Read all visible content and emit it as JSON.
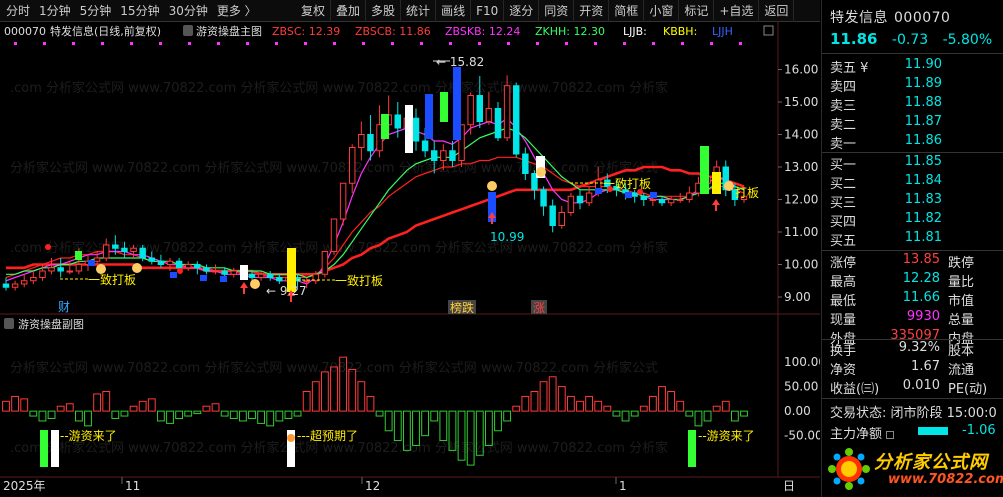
{
  "toolbar": {
    "periods": [
      "分时",
      "1分钟",
      "5分钟",
      "15分钟",
      "30分钟",
      "更多 〉"
    ],
    "buttons": [
      "复权",
      "叠加",
      "多股",
      "统计",
      "画线",
      "F10",
      "逐分",
      "同资",
      "开资",
      "简框",
      "小窗",
      "标记",
      "+自选",
      "返回"
    ]
  },
  "main_header": {
    "code": "000070",
    "name": "特发信息(日线,前复权)",
    "indicator": "游资操盘主图",
    "items": [
      {
        "label": "ZBSC: 12.39",
        "color": "#ff3b3b"
      },
      {
        "label": "ZBSCB: 11.86",
        "color": "#ff3b3b"
      },
      {
        "label": "ZBSKB: 12.24",
        "color": "#ff33ff"
      },
      {
        "label": "ZKHH: 12.30",
        "color": "#33ff66"
      },
      {
        "label": "LJJB:",
        "color": "#ffffff"
      },
      {
        "label": "KBBH:",
        "color": "#ffff00"
      },
      {
        "label": "LJJH",
        "color": "#3366ff"
      }
    ]
  },
  "sub_header": {
    "indicator": "游资操盘副图"
  },
  "annotations": {
    "high": "15.82",
    "low_a": "9.27",
    "low_b": "10.99",
    "yidaban_a": "一致打板",
    "yidaban_b": "一致打板",
    "yidaban_c": "一致打板",
    "bang_die": "榜跌",
    "zhang": "涨",
    "cai": "财",
    "youzi_a": "游资来了",
    "chaoyuqi": "超预期了",
    "youzi_b": "游资来了"
  },
  "date_axis": {
    "labels": [
      "2025年",
      "11",
      "12",
      "1",
      "日"
    ]
  },
  "chart_data": {
    "type": "candlestick",
    "y_ticks_main": [
      "16.00",
      "15.00",
      "14.00",
      "13.00",
      "12.00",
      "11.00",
      "10.00",
      "9.00"
    ],
    "y_ticks_sub": [
      "100.00",
      "50.00",
      "0.00",
      "-50.00"
    ],
    "ylim_main": [
      8.6,
      16.6
    ],
    "ylim_sub": [
      -120,
      145
    ],
    "candles": [
      [
        9.4,
        9.3,
        9.6,
        9.2
      ],
      [
        9.3,
        9.4,
        9.5,
        9.2
      ],
      [
        9.4,
        9.5,
        9.7,
        9.3
      ],
      [
        9.5,
        9.6,
        9.8,
        9.4
      ],
      [
        9.6,
        9.8,
        10.0,
        9.5
      ],
      [
        9.8,
        9.9,
        10.2,
        9.7
      ],
      [
        9.9,
        9.8,
        10.2,
        9.6
      ],
      [
        9.8,
        9.8,
        10.1,
        9.7
      ],
      [
        9.8,
        10.0,
        10.5,
        9.7
      ],
      [
        10.0,
        10.1,
        10.3,
        9.8
      ],
      [
        10.1,
        10.2,
        10.4,
        10.0
      ],
      [
        10.2,
        10.6,
        10.8,
        10.1
      ],
      [
        10.6,
        10.5,
        10.9,
        10.3
      ],
      [
        10.5,
        10.4,
        10.7,
        10.2
      ],
      [
        10.4,
        10.5,
        10.6,
        10.2
      ],
      [
        10.5,
        10.2,
        10.6,
        10.1
      ],
      [
        10.2,
        10.1,
        10.4,
        10.0
      ],
      [
        10.1,
        10.0,
        10.3,
        9.9
      ],
      [
        10.0,
        10.1,
        10.2,
        9.8
      ],
      [
        10.1,
        9.9,
        10.2,
        9.8
      ],
      [
        9.9,
        10.0,
        10.1,
        9.8
      ],
      [
        10.0,
        9.9,
        10.1,
        9.7
      ],
      [
        9.9,
        9.8,
        10.0,
        9.7
      ],
      [
        9.8,
        9.8,
        10.0,
        9.7
      ],
      [
        9.8,
        9.7,
        9.9,
        9.6
      ],
      [
        9.7,
        9.8,
        9.9,
        9.6
      ],
      [
        9.8,
        9.7,
        9.9,
        9.6
      ],
      [
        9.7,
        9.6,
        9.8,
        9.5
      ],
      [
        9.6,
        9.7,
        9.8,
        9.5
      ],
      [
        9.7,
        9.6,
        9.8,
        9.5
      ],
      [
        9.6,
        9.5,
        9.7,
        9.4
      ],
      [
        9.5,
        9.6,
        9.7,
        9.4
      ],
      [
        9.6,
        9.5,
        9.7,
        9.3
      ],
      [
        9.5,
        9.5,
        9.6,
        9.27
      ],
      [
        9.5,
        9.7,
        9.8,
        9.4
      ],
      [
        9.7,
        10.4,
        10.4,
        9.6
      ],
      [
        10.4,
        11.4,
        11.4,
        10.3
      ],
      [
        11.4,
        12.5,
        12.5,
        11.2
      ],
      [
        12.5,
        13.6,
        13.7,
        12.2
      ],
      [
        13.6,
        14.0,
        14.4,
        13.2
      ],
      [
        14.0,
        13.5,
        14.6,
        13.2
      ],
      [
        13.5,
        14.3,
        14.9,
        13.3
      ],
      [
        14.3,
        14.6,
        15.2,
        14.0
      ],
      [
        14.6,
        14.2,
        15.0,
        13.9
      ],
      [
        14.2,
        14.5,
        14.9,
        14.0
      ],
      [
        14.5,
        13.8,
        14.8,
        13.5
      ],
      [
        13.8,
        13.5,
        14.2,
        13.3
      ],
      [
        13.5,
        13.2,
        13.8,
        12.8
      ],
      [
        13.2,
        13.5,
        13.7,
        12.9
      ],
      [
        13.5,
        13.2,
        13.8,
        13.0
      ],
      [
        13.2,
        14.3,
        14.3,
        13.0
      ],
      [
        14.3,
        15.2,
        15.3,
        14.0
      ],
      [
        15.2,
        14.4,
        15.8,
        14.2
      ],
      [
        14.4,
        14.8,
        15.3,
        14.3
      ],
      [
        14.8,
        13.9,
        15.0,
        13.8
      ],
      [
        13.9,
        15.5,
        15.82,
        13.8
      ],
      [
        15.5,
        13.4,
        15.6,
        13.3
      ],
      [
        13.4,
        12.8,
        13.6,
        12.6
      ],
      [
        12.8,
        12.3,
        12.9,
        12.0
      ],
      [
        12.3,
        11.8,
        12.4,
        11.5
      ],
      [
        11.8,
        11.2,
        12.0,
        10.99
      ],
      [
        11.2,
        11.6,
        11.8,
        11.1
      ],
      [
        11.6,
        12.1,
        12.2,
        11.5
      ],
      [
        12.1,
        11.9,
        12.3,
        11.7
      ],
      [
        11.9,
        12.2,
        12.4,
        11.8
      ],
      [
        12.2,
        12.6,
        13.0,
        12.1
      ],
      [
        12.6,
        12.4,
        12.8,
        12.2
      ],
      [
        12.4,
        12.3,
        12.6,
        12.1
      ],
      [
        12.3,
        12.2,
        12.5,
        12.0
      ],
      [
        12.2,
        12.1,
        12.3,
        11.9
      ],
      [
        12.1,
        12.0,
        12.2,
        11.8
      ],
      [
        12.0,
        12.0,
        12.1,
        11.8
      ],
      [
        12.0,
        11.9,
        12.1,
        11.8
      ],
      [
        11.9,
        12.0,
        12.1,
        11.8
      ],
      [
        12.0,
        12.0,
        12.2,
        11.9
      ],
      [
        12.0,
        12.2,
        12.4,
        11.9
      ],
      [
        12.2,
        12.5,
        12.7,
        12.1
      ],
      [
        12.5,
        12.7,
        13.1,
        12.4
      ],
      [
        12.7,
        13.0,
        13.2,
        12.5
      ],
      [
        13.0,
        12.3,
        13.2,
        12.1
      ],
      [
        12.3,
        12.0,
        12.5,
        11.8
      ],
      [
        12.0,
        12.1,
        12.4,
        11.9
      ]
    ],
    "sub_bars": [
      20,
      30,
      25,
      -10,
      -20,
      -15,
      10,
      15,
      -20,
      -30,
      35,
      40,
      -15,
      -10,
      10,
      20,
      25,
      -20,
      -25,
      -15,
      -10,
      -5,
      10,
      15,
      -10,
      -15,
      -20,
      -15,
      -25,
      -30,
      -20,
      -15,
      -10,
      40,
      60,
      80,
      90,
      110,
      85,
      60,
      30,
      -10,
      -40,
      -60,
      -80,
      -70,
      -50,
      -20,
      -60,
      -80,
      -100,
      -110,
      -90,
      -70,
      -40,
      -20,
      10,
      30,
      40,
      60,
      70,
      50,
      30,
      20,
      30,
      20,
      10,
      -10,
      -20,
      -10,
      10,
      30,
      50,
      40,
      20,
      -10,
      -30,
      -20,
      10,
      20,
      -20,
      -10
    ],
    "series": [
      {
        "name": "ZBSC",
        "values": [
          9.6,
          9.7,
          9.8,
          9.9,
          10.0,
          10.1,
          10.2,
          10.2,
          10.3,
          10.3,
          10.4,
          10.4,
          10.4,
          10.3,
          10.3,
          10.2,
          10.1,
          10.1,
          10.0,
          10.0,
          9.9,
          9.9,
          9.9,
          9.8,
          9.8,
          9.8,
          9.7,
          9.7,
          9.7,
          9.6,
          9.6,
          9.6,
          9.6,
          9.6,
          9.7,
          9.9,
          10.2,
          10.6,
          11.0,
          11.3,
          11.6,
          11.8,
          12.1,
          12.3,
          12.5,
          12.7,
          12.8,
          12.9,
          13.0,
          13.0,
          13.1,
          13.1,
          13.2,
          13.2,
          13.3,
          13.3,
          13.3,
          13.2,
          13.1,
          13.0,
          12.8,
          12.6,
          12.5,
          12.4,
          12.4,
          12.4,
          12.4,
          12.3,
          12.3,
          12.2,
          12.2,
          12.1,
          12.1,
          12.1,
          12.1,
          12.1,
          12.2,
          12.3,
          12.4,
          12.4,
          12.3,
          12.2
        ]
      },
      {
        "name": "ZBSCB",
        "values": [
          9.9,
          9.9,
          9.9,
          10.0,
          10.0,
          10.0,
          10.0,
          10.0,
          10.0,
          10.0,
          10.0,
          10.0,
          10.0,
          10.0,
          10.0,
          9.9,
          9.9,
          9.9,
          9.9,
          9.9,
          9.9,
          9.9,
          9.8,
          9.8,
          9.8,
          9.8,
          9.8,
          9.8,
          9.7,
          9.7,
          9.7,
          9.7,
          9.7,
          9.7,
          9.7,
          9.8,
          9.9,
          10.0,
          10.2,
          10.3,
          10.5,
          10.6,
          10.8,
          10.9,
          11.0,
          11.2,
          11.3,
          11.4,
          11.5,
          11.6,
          11.7,
          11.8,
          11.9,
          12.0,
          12.1,
          12.2,
          12.3,
          12.3,
          12.3,
          12.3,
          12.3,
          12.3,
          12.3,
          12.4,
          12.5,
          12.6,
          12.7,
          12.8,
          12.9,
          12.9,
          13.0,
          13.0,
          13.0,
          12.9,
          12.9,
          12.8,
          12.8,
          12.7,
          12.7,
          12.6,
          12.5,
          12.4
        ]
      },
      {
        "name": "ZBSKB",
        "values": [
          9.5,
          9.6,
          9.7,
          9.8,
          9.9,
          10.0,
          10.0,
          10.1,
          10.2,
          10.3,
          10.3,
          10.4,
          10.4,
          10.4,
          10.3,
          10.3,
          10.2,
          10.1,
          10.0,
          10.0,
          9.9,
          9.9,
          9.8,
          9.8,
          9.7,
          9.7,
          9.7,
          9.6,
          9.6,
          9.6,
          9.5,
          9.5,
          9.5,
          9.4,
          9.6,
          10.0,
          10.6,
          11.3,
          12.1,
          12.8,
          13.3,
          13.7,
          14.0,
          14.1,
          14.2,
          14.1,
          14.0,
          13.8,
          13.8,
          13.7,
          13.9,
          14.2,
          14.3,
          14.4,
          14.3,
          14.5,
          14.2,
          13.8,
          13.3,
          12.8,
          12.3,
          12.0,
          11.9,
          11.9,
          12.0,
          12.2,
          12.3,
          12.3,
          12.2,
          12.2,
          12.1,
          12.0,
          12.0,
          12.0,
          12.0,
          12.1,
          12.3,
          12.5,
          12.7,
          12.6,
          12.4,
          12.3
        ]
      },
      {
        "name": "ZKHH",
        "values": [
          9.7,
          9.7,
          9.8,
          9.8,
          9.9,
          9.9,
          10.0,
          10.0,
          10.1,
          10.1,
          10.2,
          10.2,
          10.2,
          10.2,
          10.2,
          10.2,
          10.1,
          10.1,
          10.1,
          10.0,
          10.0,
          10.0,
          9.9,
          9.9,
          9.9,
          9.8,
          9.8,
          9.8,
          9.8,
          9.7,
          9.7,
          9.7,
          9.7,
          9.6,
          9.7,
          9.8,
          10.0,
          10.3,
          10.7,
          11.1,
          11.5,
          11.9,
          12.3,
          12.6,
          12.9,
          13.1,
          13.2,
          13.3,
          13.3,
          13.3,
          13.5,
          13.7,
          13.9,
          14.0,
          14.1,
          14.2,
          14.1,
          13.9,
          13.6,
          13.3,
          13.0,
          12.7,
          12.5,
          12.3,
          12.3,
          12.3,
          12.3,
          12.3,
          12.2,
          12.2,
          12.1,
          12.1,
          12.1,
          12.0,
          12.0,
          12.1,
          12.2,
          12.3,
          12.5,
          12.5,
          12.4,
          12.3
        ]
      }
    ]
  },
  "quote": {
    "name": "特发信息",
    "code": "000070",
    "price": "11.86",
    "change": "-0.73",
    "pct": "-5.80%",
    "asks": [
      {
        "label": "卖五",
        "mark": "¥",
        "price": "11.90"
      },
      {
        "label": "卖四",
        "mark": "",
        "price": "11.89"
      },
      {
        "label": "卖三",
        "mark": "",
        "price": "11.88"
      },
      {
        "label": "卖二",
        "mark": "",
        "price": "11.87"
      },
      {
        "label": "卖一",
        "mark": "",
        "price": "11.86"
      }
    ],
    "bids": [
      {
        "label": "买一",
        "price": "11.85"
      },
      {
        "label": "买二",
        "price": "11.84"
      },
      {
        "label": "买三",
        "price": "11.83"
      },
      {
        "label": "买四",
        "price": "11.82"
      },
      {
        "label": "买五",
        "price": "11.81"
      }
    ],
    "stats1": [
      {
        "k1": "涨停",
        "v1": "13.85",
        "c": "red",
        "k2": "跌停"
      },
      {
        "k1": "最高",
        "v1": "12.28",
        "c": "cyan",
        "k2": "量比"
      },
      {
        "k1": "最低",
        "v1": "11.66",
        "c": "cyan",
        "k2": "市值"
      },
      {
        "k1": "现量",
        "v1": "9930",
        "c": "magenta",
        "k2": "总量"
      },
      {
        "k1": "外盘",
        "v1": "335097",
        "c": "red",
        "k2": "内盘"
      }
    ],
    "stats2": [
      {
        "k1": "换手",
        "v1": "9.32%",
        "c": "white",
        "k2": "股本"
      },
      {
        "k1": "净资",
        "v1": "1.67",
        "c": "white",
        "k2": "流通"
      },
      {
        "k1": "收益(㈢)",
        "v1": "0.010",
        "c": "white",
        "k2": "PE(动)"
      }
    ],
    "state_label": "交易状态:",
    "state_value": "闭市阶段 15:00:0",
    "flow_label": "主力净额",
    "flow_value": "-1.06"
  },
  "brand": {
    "name": "分析家公式网",
    "url": "www.70822.com"
  },
  "colors": {
    "up": "#ff3b3b",
    "down": "#00e5e5",
    "ma_red": "#ff2020",
    "ma_magenta": "#ff33ff",
    "ma_green": "#33ff66",
    "ma_white": "#ffffff",
    "bar_up": "#ff3b3b",
    "bar_down": "#33cc33"
  }
}
